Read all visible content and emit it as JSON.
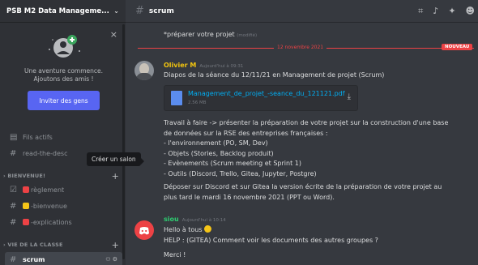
{
  "guild": {
    "name": "PSB M2 Data Manageme...",
    "chevron": "chevron-down-icon"
  },
  "invite": {
    "line1": "Une aventure commence.",
    "line2": "Ajoutons des amis !",
    "button": "Inviter des gens"
  },
  "sidebar": {
    "threads": "Fils actifs",
    "read_desc": "read-the-desc",
    "cat_bienvenue": "BIENVENUE!",
    "reglement": "règlement",
    "bienvenue": "-bienvenue",
    "explications": "-explications",
    "cat_vie": "VIE DE LA CLASSE",
    "scrum": "scrum",
    "tooltip": "Créer un salon"
  },
  "topbar": {
    "channel": "scrum"
  },
  "messages": {
    "prev_line": "*préparer votre projet",
    "prev_edited": "(modifié)",
    "divider_date": "12 novembre 2021",
    "new_badge": "NOUVEAU",
    "m1": {
      "author": "Olivier M",
      "timestamp": "Aujourd'hui à 09:31",
      "line": "Diapos de la séance du 12/11/21 en Management de projet (Scrum)",
      "file_name": "Management_de_projet_-seance_du_121121.pdf",
      "file_size": "2.56 MB",
      "p1": "Travail à faire -> présenter la préparation de votre projet sur la construction d'une base",
      "p2": "de données sur la RSE des entreprises françaises :",
      "b1": "- l'environnement (PO, SM, Dev)",
      "b2": "- Objets (Stories, Backlog produit)",
      "b3": "- Evènements (Scrum meeting et Sprint 1)",
      "b4": "- Outils (Discord, Trello, Gitea, Jupyter, Postgre)",
      "p3": "Déposer sur Discord et sur Gitea la version écrite de la préparation de votre projet au",
      "p4": "plus tard le mardi 16 novembre 2021 (PPT ou Word)."
    },
    "m2": {
      "author": "siou",
      "timestamp": "Aujourd'hui à 10:14",
      "l1": "Hello à tous",
      "l2": "HELP : (GITEA) Comment voir les documents des autres groupes ?",
      "l3": "Merci !"
    }
  },
  "colors": {
    "accent": "#5865f2",
    "new": "#ed4245",
    "author1": "#f1c40f",
    "author2": "#2ecc71"
  }
}
